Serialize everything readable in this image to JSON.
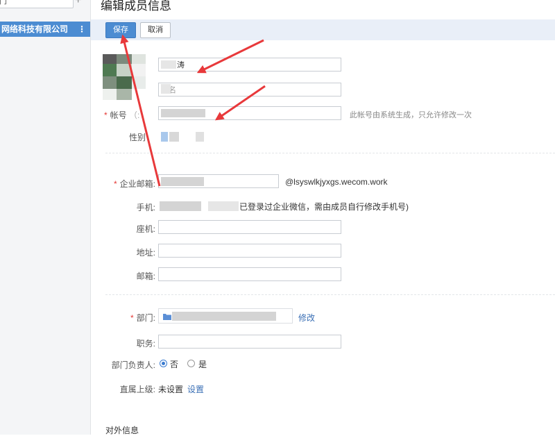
{
  "sidebar": {
    "search_text": "门",
    "add_symbol": "+",
    "org_name": "网络科技有限公司",
    "org_more": "⋮"
  },
  "page_title": "编辑成员信息",
  "toolbar": {
    "save_label": "保存",
    "cancel_label": "取消"
  },
  "basic": {
    "name_value": "涛",
    "alias_value": "名",
    "account_label": "帐号",
    "account_label_tail": "（:",
    "account_hint": "此帐号由系统生成，只允许修改一次",
    "gender_label": "性别"
  },
  "contact": {
    "email_label": "企业邮箱:",
    "email_domain": "@lsyswlkjyxgs.wecom.work",
    "mobile_label": "手机:",
    "mobile_hint": "已登录过企业微信，需由成员自行修改手机号)",
    "phone_label": "座机:",
    "address_label": "地址:",
    "mail_label": "邮箱:"
  },
  "org": {
    "dept_label": "部门:",
    "dept_edit_link": "修改",
    "position_label": "职务:",
    "leader_label": "部门负责人:",
    "leader_no": "否",
    "leader_yes": "是",
    "supervisor_label": "直属上级:",
    "supervisor_value": "未设置",
    "supervisor_link": "设置"
  },
  "external_label": "对外信息",
  "colors": {
    "accent": "#4c8cd2",
    "required": "#e53935",
    "link": "#3a6fb5",
    "annotation_arrow": "#e8393b"
  }
}
